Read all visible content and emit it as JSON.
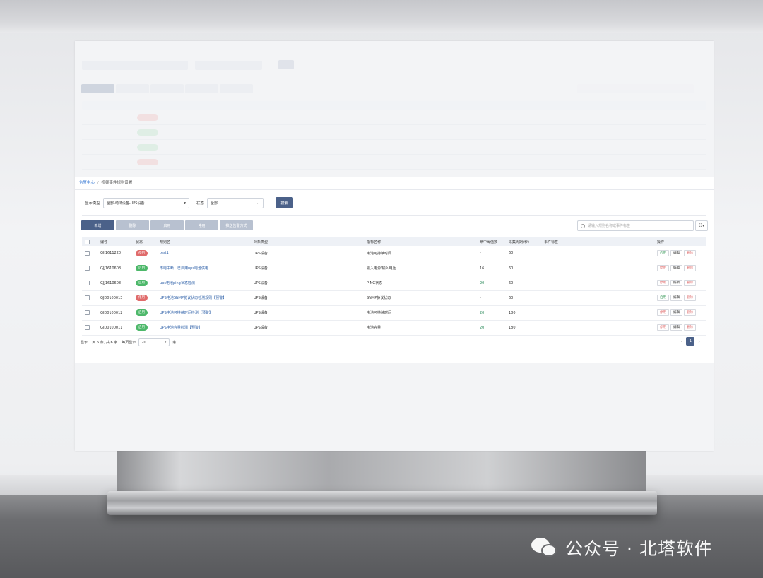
{
  "breadcrumb": {
    "root": "告警中心",
    "current": "视频事件规则设置"
  },
  "filters": {
    "display_type_label": "显示类型",
    "display_type_value": "全部-动环设备-UPS设备",
    "status_label": "状态",
    "status_value": "全部",
    "search_button": "搜索"
  },
  "toolbar": {
    "add": "新增",
    "delete": "删除",
    "enable": "启用",
    "disable": "停用",
    "notify": "推送告警方式"
  },
  "search": {
    "placeholder": "请输入规则名称或事件标签"
  },
  "table": {
    "headers": [
      "编号",
      "状态",
      "规则名",
      "对象类型",
      "指标名称",
      "命中阈值数",
      "采集周期(秒)",
      "事件标签",
      "操作"
    ],
    "rows": [
      {
        "id": "GJJ1611220",
        "status": "停用",
        "status_type": "stop",
        "name": "test1",
        "object": "UPS设备",
        "metric": "电池可持续时间",
        "hits": "-",
        "period": "60",
        "tag": "",
        "toggle": "启用"
      },
      {
        "id": "GJJ1610608",
        "status": "启用",
        "status_type": "on",
        "name": "市电中断、已启用ups电池供电",
        "object": "UPS设备",
        "metric": "输入电源/输入电压",
        "hits": "16",
        "period": "60",
        "tag": "",
        "toggle": "停用"
      },
      {
        "id": "GJJ1610608",
        "status": "启用",
        "status_type": "on",
        "name": "ups电池ping状态检测",
        "object": "UPS设备",
        "metric": "PING状态",
        "hits": "20",
        "period": "60",
        "tag": "",
        "toggle": "停用"
      },
      {
        "id": "GJD0100013",
        "status": "停用",
        "status_type": "stop",
        "name": "UPS电池SNMP协议状态检测规则【预警】",
        "object": "UPS设备",
        "metric": "SNMP协议状态",
        "hits": "-",
        "period": "60",
        "tag": "",
        "toggle": "启用"
      },
      {
        "id": "GJD0100012",
        "status": "启用",
        "status_type": "on",
        "name": "UPS电池可持续时间检测【预警】",
        "object": "UPS设备",
        "metric": "电池可持续时间",
        "hits": "20",
        "period": "180",
        "tag": "",
        "toggle": "停用"
      },
      {
        "id": "GJD0100011",
        "status": "启用",
        "status_type": "on",
        "name": "UPS电池容量检测【预警】",
        "object": "UPS设备",
        "metric": "电池容量",
        "hits": "20",
        "period": "180",
        "tag": "",
        "toggle": "停用"
      }
    ],
    "edit_label": "编辑",
    "delete_label": "删除"
  },
  "pagination": {
    "summary": "显示 1 到 6 条, 共 6 条",
    "page_size_label": "每页显示",
    "page_size": "20",
    "unit": "条",
    "current_page": "1",
    "prev": "‹",
    "next": "›"
  },
  "watermark": {
    "text": "公众号 · 北塔软件"
  },
  "colors": {
    "primary": "#4b6189",
    "danger": "#e06b6b",
    "success": "#4db86a",
    "link": "#2b5ea7"
  }
}
